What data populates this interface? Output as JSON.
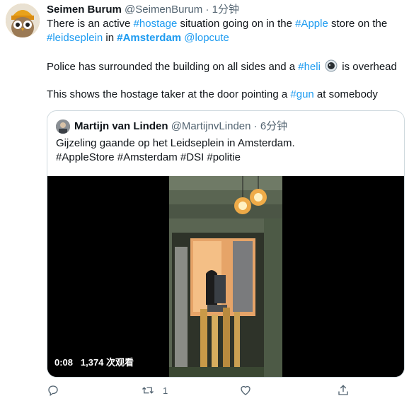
{
  "author": {
    "name": "Seimen Burum",
    "handle": "@SeimenBurum",
    "dot": "·",
    "time": "1分钟"
  },
  "tweet": {
    "line1": {
      "t1": "There is an active ",
      "h1": "#hostage",
      "t2": " situation going on in the ",
      "h2": "#Apple",
      "t3": " store on the"
    },
    "line2": {
      "h1": "#leidseplein",
      "t1": " in ",
      "h2": "#Amsterdam",
      "t2": " ",
      "h3": "@lopcute"
    },
    "line3": {
      "t1": "Police has surrounded the building on all sides and a ",
      "h1": "#heli",
      "t2": " is overhead"
    },
    "line4": {
      "t1": "This shows the hostage taker at the door pointing a ",
      "h1": "#gun",
      "t2": " at somebody"
    }
  },
  "quote": {
    "name": "Martijn van Linden",
    "handle": "@MartijnvLinden",
    "dot": "·",
    "time": "6分钟",
    "text1": "Gijzeling gaande op het Leidseplein in Amsterdam.",
    "text2": "#AppleStore #Amsterdam #DSI #politie",
    "video": {
      "time": "0:08",
      "views": "1,374 次观看"
    }
  },
  "actions": {
    "reply_icon": "reply-icon",
    "retweet_icon": "retweet-icon",
    "retweet_count": "1",
    "like_icon": "like-icon",
    "share_icon": "share-icon"
  },
  "colors": {
    "link": "#1d9bf0",
    "muted": "#536471",
    "border": "#cfd9de"
  }
}
